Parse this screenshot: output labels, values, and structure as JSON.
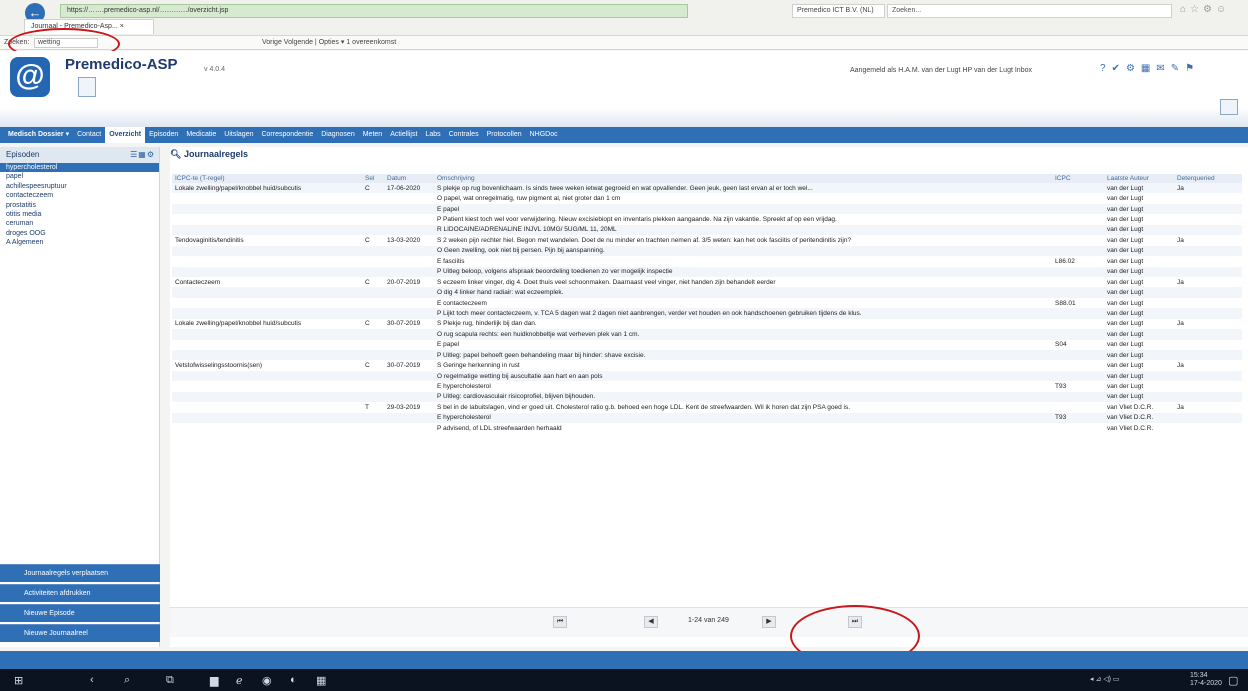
{
  "browser": {
    "address": "https://…….premedico-asp.nl/…………/overzicht.jsp",
    "tab_label": "Journaal - Premedico-Asp... ×",
    "right_field": "Premedico ICT B.V. (NL)",
    "search_field": "Zoeken...",
    "find_label": "Zoeken:",
    "find_value": "wetting",
    "find_controls": "Vorige  Volgende  |  Opties ▾  1 overeenkomst"
  },
  "app": {
    "name": "Premedico-ASP",
    "version": "v 4.0.4",
    "user_text": "Aangemeld als H.A.M. van der Lugt   HP van der Lugt    Inbox"
  },
  "nav": {
    "items": [
      "Medisch Dossier ▾",
      "Contact",
      "Overzicht",
      "Episoden",
      "Medicatie",
      "Uitslagen",
      "Correspondentie",
      "Diagnosen",
      "Meten",
      "Actiellijst",
      "Labs",
      "Contrales",
      "Protocollen",
      "NHGDoc"
    ]
  },
  "sidebar": {
    "title": "Episoden",
    "episodes": [
      "hypercholesterol",
      "papel",
      "achillespeesruptuur",
      "contacteczeem",
      "prostatitis",
      "otitis media",
      "ceruman",
      "droges OOG",
      "A Algemeen"
    ],
    "buttons": [
      "Journaalregels verplaatsen",
      "Activiteiten afdrukken",
      "Nieuwe Episode",
      "Nieuwe Journaalreel"
    ]
  },
  "content": {
    "title": "Journaalregels",
    "columns": [
      "ICPC-te (T-regel)",
      "Sel",
      "Datum",
      "Omschrijving",
      "ICPC",
      "Laatste Auteur",
      "Deterqueried"
    ],
    "rows": [
      [
        "Lokale zwelling/papel/knobbel huid/subcutis",
        "C",
        "17-06-2020",
        "S  plekje op rug bovenlichaam. Is sinds twee weken ietwat gegroeid en wat opvallender. Geen jeuk, geen last ervan al er toch wel...",
        "",
        "van der Lugt",
        "Ja"
      ],
      [
        "",
        "",
        "",
        "O  papel, wat onregelmatig, ruw pigment al, niet groter dan 1 cm",
        "",
        "van der Lugt",
        ""
      ],
      [
        "",
        "",
        "",
        "E  papel",
        "",
        "van der Lugt",
        ""
      ],
      [
        "",
        "",
        "",
        "P  Patient kiest toch wel voor verwijdering. Nieuw excisiebiopt en inventaris plekken aangaande. Na zijn vakantie. Spreekt af op een vrijdag.",
        "",
        "van der Lugt",
        ""
      ],
      [
        "",
        "",
        "",
        "R  LIDOCAINE/ADRENALINE INJVL 10MG/ 5UG/ML 11, 20ML",
        "",
        "van der Lugt",
        ""
      ],
      [
        "Tendovaginitis/tendinitis",
        "C",
        "13-03-2020",
        "S  2 weken pijn rechter hiel. Begon met wandelen. Doet de nu minder en trachten nemen af. 3/5 weten: kan het ook fasciitis of peritendinitis zijn?",
        "",
        "van der Lugt",
        "Ja"
      ],
      [
        "",
        "",
        "",
        "O  Geen zwelling, ook niet bij persen. Pijn bij aanspanning.",
        "",
        "van der Lugt",
        ""
      ],
      [
        "",
        "",
        "",
        "E  fasciitis",
        "L86.02",
        "van der Lugt",
        ""
      ],
      [
        "",
        "",
        "",
        "P  Uitleg beloop, volgens afspraak beoordeling toedienen zo ver mogelijk inspectie",
        "",
        "van der Lugt",
        ""
      ],
      [
        "Contacteczeem",
        "C",
        "20-07-2019",
        "S  eczeem linker vinger, dig 4. Doet thuis veel schoonmaken. Daarnaast veel vinger, niet handen zijn behandelt eerder",
        "",
        "van der Lugt",
        "Ja"
      ],
      [
        "",
        "",
        "",
        "O  dig 4 linker hand radiair: wat eczeemplek.",
        "",
        "van der Lugt",
        ""
      ],
      [
        "",
        "",
        "",
        "E  contacteczeem",
        "S88.01",
        "van der Lugt",
        ""
      ],
      [
        "",
        "",
        "",
        "P  Lijkt toch meer contacteczeem, v. TCA 5 dagen wat 2 dagen niet aanbrengen, verder vet houden en ook handschoenen gebruiken tijdens de klus.",
        "",
        "van der Lugt",
        ""
      ],
      [
        "Lokale zwelling/papel/knobbel huid/subcutis",
        "C",
        "30-07-2019",
        "S  Plekje rug, hinderlijk bij dan dan.",
        "",
        "van der Lugt",
        "Ja"
      ],
      [
        "",
        "",
        "",
        "O  rug scapula rechts: een huidknobbeltje wat verheven plek van 1 cm.",
        "",
        "van der Lugt",
        ""
      ],
      [
        "",
        "",
        "",
        "E  papel",
        "S04",
        "van der Lugt",
        ""
      ],
      [
        "",
        "",
        "",
        "P  Uitleg: papel behoeft geen behandeling maar bij hinder: shave excisie.",
        "",
        "van der Lugt",
        ""
      ],
      [
        "Vetstofwisselingsstoornis(sen)",
        "C",
        "30-07-2019",
        "S  Geringe herkenning in rust",
        "",
        "van der Lugt",
        "Ja"
      ],
      [
        "",
        "",
        "",
        "O  regelmatige wetting bij auscultatie aan hart en aan pols",
        "",
        "van der Lugt",
        ""
      ],
      [
        "",
        "",
        "",
        "E  hypercholesterol",
        "T93",
        "van der Lugt",
        ""
      ],
      [
        "",
        "",
        "",
        "P  Uitleg: cardiovasculair risicoprofiel, blijven bijhouden.",
        "",
        "van der Lugt",
        ""
      ],
      [
        "",
        "T",
        "29-03-2019",
        "S  bel in de labuitslagen, vind er goed uit. Cholesterol ratio g.b. behoed een hoge LDL. Kent de streefwaarden. Wil ik horen dat zijn PSA goed is.",
        "",
        "van Vliet D.C.R.",
        "Ja"
      ],
      [
        "",
        "",
        "",
        "E  hypercholesterol",
        "T93",
        "van Vliet D.C.R.",
        ""
      ],
      [
        "",
        "",
        "",
        "P  advisend, of LDL streefwaarden herhaald",
        "",
        "van Vliet D.C.R.",
        ""
      ]
    ]
  },
  "pager": {
    "text": "1-24 van 249"
  },
  "taskbar": {
    "time": "15:34",
    "date": "17-4-2020"
  },
  "colors": {
    "accent": "#2f6fb5",
    "annotation": "#c8181b"
  }
}
